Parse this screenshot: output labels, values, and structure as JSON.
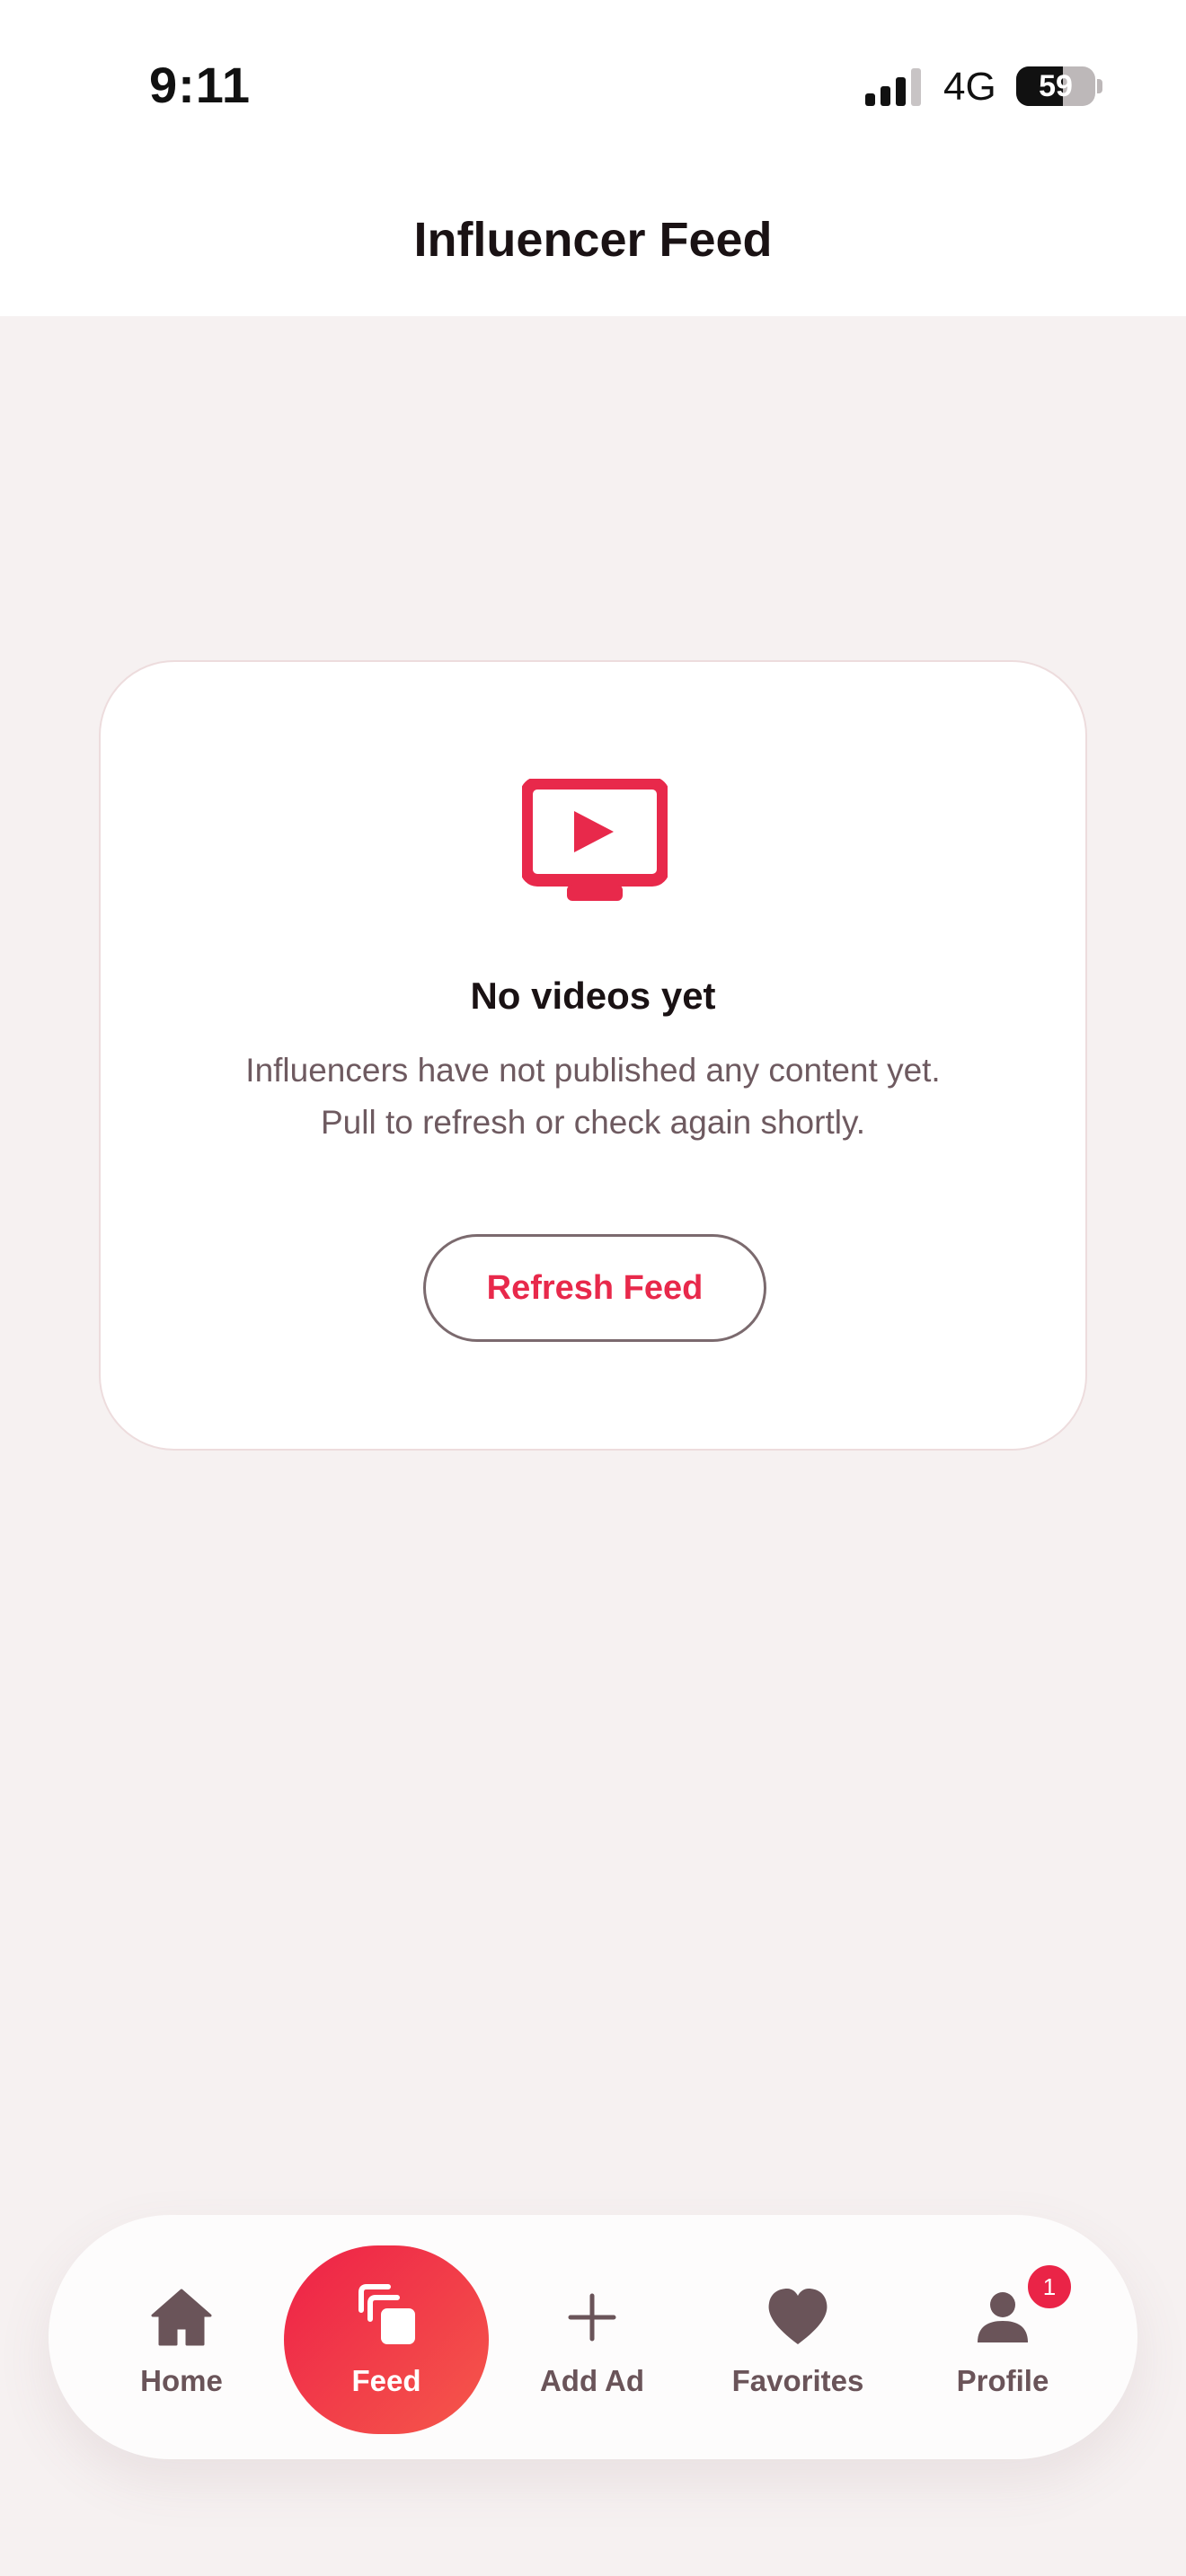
{
  "status_bar": {
    "time": "9:11",
    "network": "4G",
    "battery": "59",
    "battery_level": 0.59
  },
  "header": {
    "title": "Influencer Feed"
  },
  "empty_state": {
    "icon": "tv-play-icon",
    "title": "No videos yet",
    "message_line1": "Influencers have not published any content yet.",
    "message_line2": "Pull to refresh or check again shortly.",
    "button_label": "Refresh Feed"
  },
  "tab_bar": {
    "items": [
      {
        "label": "Home",
        "icon": "home-icon",
        "active": false
      },
      {
        "label": "Feed",
        "icon": "feed-icon",
        "active": true
      },
      {
        "label": "Add Ad",
        "icon": "plus-icon",
        "active": false
      },
      {
        "label": "Favorites",
        "icon": "heart-icon",
        "active": false
      },
      {
        "label": "Profile",
        "icon": "user-icon",
        "active": false,
        "badge": "1"
      }
    ]
  },
  "colors": {
    "accent": "#e8294b",
    "accent_gradient_end": "#f5584a",
    "background": "#f6f1f1",
    "muted_text": "#6e5a60",
    "tab_inactive": "#6a5459"
  }
}
